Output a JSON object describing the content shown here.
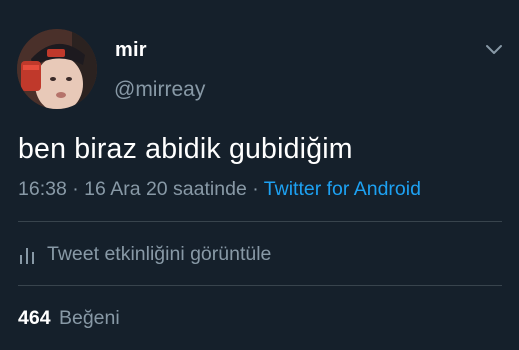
{
  "author": {
    "name": "mir",
    "handle": "@mirreay"
  },
  "tweet": {
    "text": "ben biraz abidik gubidiğim"
  },
  "meta": {
    "time": "16:38",
    "separator": "·",
    "date": "16 Ara 20 saatinde",
    "source": "Twitter for Android"
  },
  "activity": {
    "label": "Tweet etkinliğini görüntüle",
    "icon": "bar-chart-icon"
  },
  "stats": {
    "like_count": "464",
    "like_label": "Beğeni"
  },
  "colors": {
    "background": "#15202b",
    "text": "#ffffff",
    "muted": "#8899a6",
    "accent": "#1da1f2",
    "divider": "#38444d"
  }
}
